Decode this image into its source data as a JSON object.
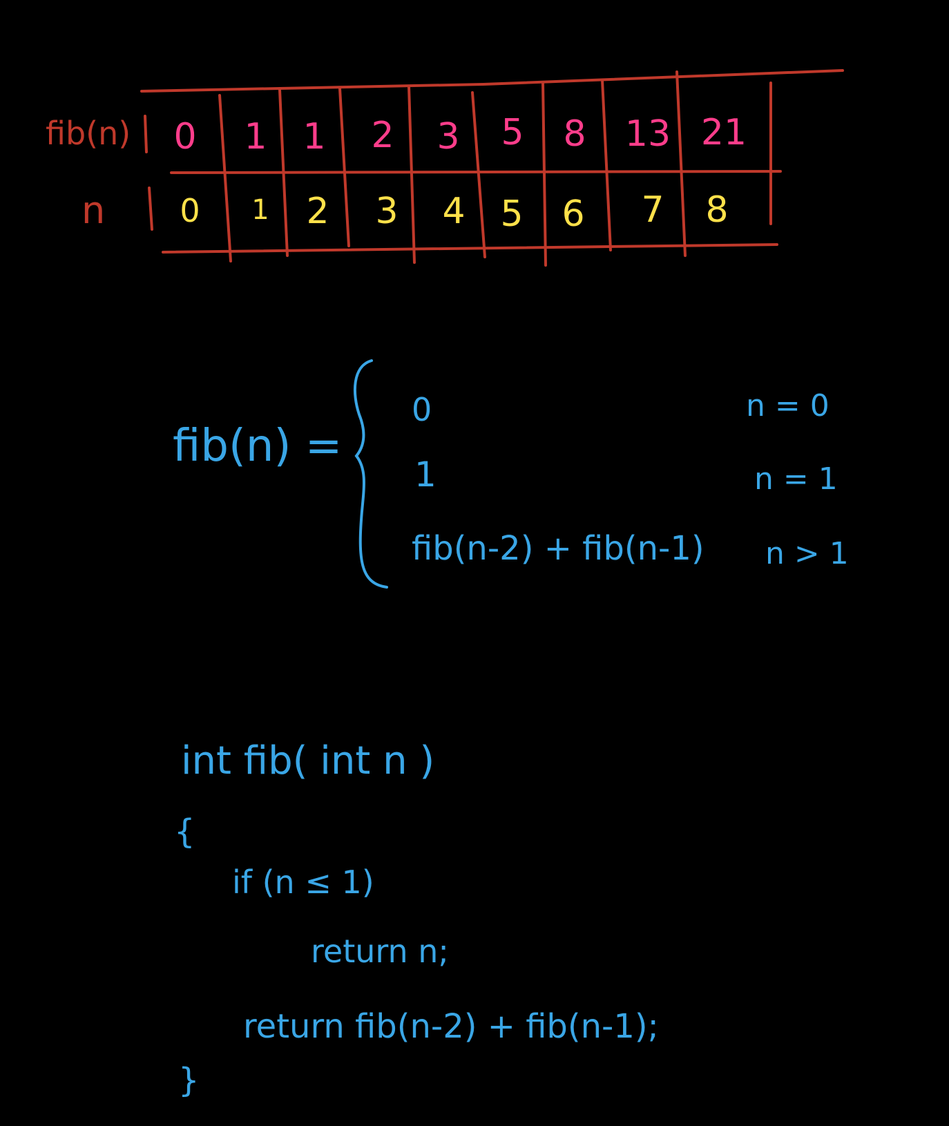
{
  "table": {
    "row_labels": {
      "fib": "fib(n)",
      "n": "n"
    },
    "fib_values": [
      "0",
      "1",
      "1",
      "2",
      "3",
      "5",
      "8",
      "13",
      "21"
    ],
    "n_values": [
      "0",
      "1",
      "2",
      "3",
      "4",
      "5",
      "6",
      "7",
      "8"
    ],
    "colors": {
      "lines": "#c0392b",
      "fib": "#ff3d8b",
      "n": "#ffe14a"
    }
  },
  "recurrence": {
    "lhs": "fib(n) =",
    "cases": [
      {
        "value": "0",
        "condition": "n = 0"
      },
      {
        "value": "1",
        "condition": "n = 1"
      },
      {
        "value": "fib(n-2) + fib(n-1)",
        "condition": "n > 1"
      }
    ],
    "color": "#3aa6e6"
  },
  "code": {
    "lines": [
      "int fib( int n )",
      "{",
      "if (n ≤ 1)",
      "return n;",
      "return fib(n-2) + fib(n-1);",
      "}"
    ]
  }
}
